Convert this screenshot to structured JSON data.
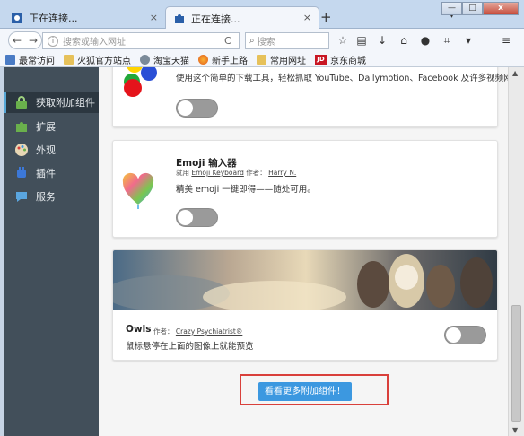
{
  "tabs": [
    {
      "title": "正在连接...",
      "close": "×"
    },
    {
      "title": "正在连接...",
      "close": "×"
    }
  ],
  "new_tab": "+",
  "tabs_menu": "▾",
  "window_controls": {
    "minimize": "—",
    "maximize": "□",
    "close": "x"
  },
  "nav": {
    "back": "←",
    "forward": "→",
    "url_placeholder": "搜索或输入网址",
    "reload": "C",
    "search_placeholder": "搜索"
  },
  "toolbar_icons": [
    "star-icon",
    "library-icon",
    "download-icon",
    "home-icon",
    "chat-icon",
    "crop-icon",
    "sync-icon",
    "menu-icon"
  ],
  "bookmarks": [
    {
      "label": "最常访问",
      "icon": "folder"
    },
    {
      "label": "火狐官方站点",
      "icon": "folder"
    },
    {
      "label": "淘宝天猫",
      "icon": "globe"
    },
    {
      "label": "新手上路",
      "icon": "firefox"
    },
    {
      "label": "常用网址",
      "icon": "folder"
    },
    {
      "label": "京东商城",
      "icon": "jd",
      "badge": "JD"
    }
  ],
  "sidebar": {
    "items": [
      {
        "label": "获取附加组件",
        "icon": "get-addons-icon",
        "selected": true
      },
      {
        "label": "扩展",
        "icon": "puzzle-icon",
        "selected": false
      },
      {
        "label": "外观",
        "icon": "palette-icon",
        "selected": false
      },
      {
        "label": "插件",
        "icon": "plugin-icon",
        "selected": false
      },
      {
        "label": "服务",
        "icon": "services-icon",
        "selected": false
      }
    ]
  },
  "addons": [
    {
      "description": "使用这个简单的下载工具，轻松抓取 YouTube、Dailymotion、Facebook 及许多视频网站的视频。"
    },
    {
      "title": "Emoji 输入器",
      "by_prefix": "就用",
      "by_name": "Emoji Keyboard",
      "author_prefix": "作者：",
      "author": "Harry N.",
      "description": "精美 emoji 一键即得——随处可用。"
    },
    {
      "title": "Owls",
      "author_prefix": "作者：",
      "author": "Crazy Psychiatrist®",
      "description": "鼠标悬停在上面的图像上就能预览"
    }
  ],
  "more_button": "看看更多附加组件！",
  "colors": {
    "accent": "#3c98e0",
    "highlight_box": "#d9403b",
    "sidebar_bg": "#424f5a"
  }
}
